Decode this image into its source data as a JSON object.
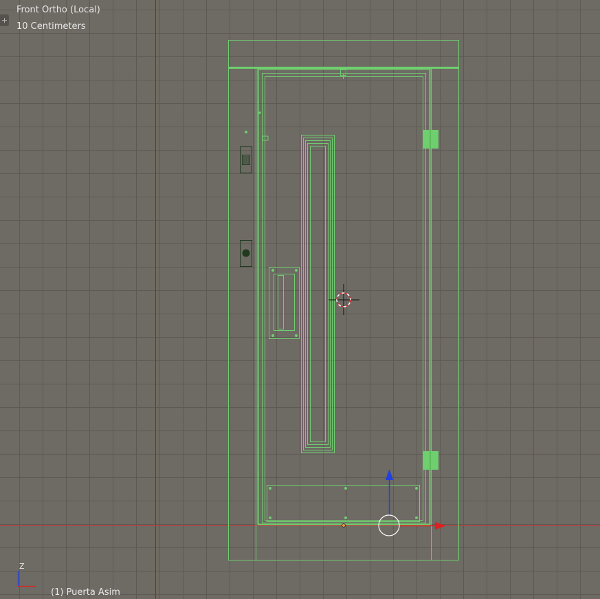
{
  "viewport": {
    "view_name": "Front Ortho (Local)",
    "grid_scale": "10 Centimeters",
    "object_name": "(1) Puerta Asim"
  },
  "toolshelf": {
    "icon": "plus-icon",
    "glyph": "+"
  },
  "axes_gizmo": {
    "up_axis": "Z"
  },
  "colors": {
    "background": "#6e6a64",
    "grid_line": "#5d5954",
    "wire_selected": "#6fcf6f",
    "wire_dark": "#1f3a1f",
    "x_axis": "#c23a3a",
    "y_axis": "#2a3fb5",
    "gizmo_x": "#e02020",
    "gizmo_z": "#2040e0"
  }
}
